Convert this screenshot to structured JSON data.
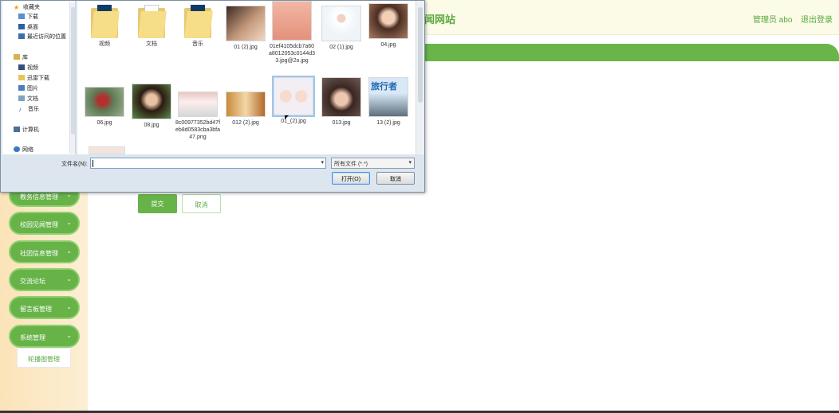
{
  "header": {
    "site_title": "闻网站",
    "user_label": "管理员 abo",
    "logout": "退出登录"
  },
  "sidebar": {
    "items": [
      {
        "label": "教务信息管理"
      },
      {
        "label": "校园见闻管理"
      },
      {
        "label": "社团信息管理"
      },
      {
        "label": "交流论坛"
      },
      {
        "label": "留言板管理"
      },
      {
        "label": "系统管理"
      }
    ],
    "sub_item": "轮播图管理"
  },
  "form": {
    "submit": "提交",
    "cancel": "取消"
  },
  "dialog": {
    "nav": {
      "favorites": "收藏夹",
      "downloads": "下载",
      "desktop": "桌面",
      "recent": "最近访问的位置",
      "library": "库",
      "videos": "视频",
      "thunder": "迅雷下载",
      "pictures": "图片",
      "documents": "文档",
      "music": "音乐",
      "computer": "计算机",
      "network": "网络"
    },
    "files": [
      {
        "name": "视频",
        "kind": "folder"
      },
      {
        "name": "文档",
        "kind": "folder"
      },
      {
        "name": "音乐",
        "kind": "folder"
      },
      {
        "name": "01 (2).jpg",
        "kind": "image"
      },
      {
        "name": "01ef4105dcb7a60a8012053c0144d33.jpg@2o.jpg",
        "kind": "image"
      },
      {
        "name": "02 (1).jpg",
        "kind": "image"
      },
      {
        "name": "04.jpg",
        "kind": "image"
      },
      {
        "name": "06.jpg",
        "kind": "image"
      },
      {
        "name": "08.jpg",
        "kind": "image"
      },
      {
        "name": "8c00977352bd47feb8d0583cba3bfa47.png",
        "kind": "image"
      },
      {
        "name": "012 (2).jpg",
        "kind": "image"
      },
      {
        "name": "01_(2).jpg",
        "kind": "image",
        "selected": true
      },
      {
        "name": "013.jpg",
        "kind": "image"
      },
      {
        "name": "13 (2).jpg",
        "kind": "image"
      }
    ],
    "thumb_text_travel": "旅行者",
    "filename_label": "文件名(N):",
    "filename_value": "",
    "filetype": "所有文件 (*.*)",
    "open_button": "打开(O)",
    "cancel_button": "取消"
  }
}
